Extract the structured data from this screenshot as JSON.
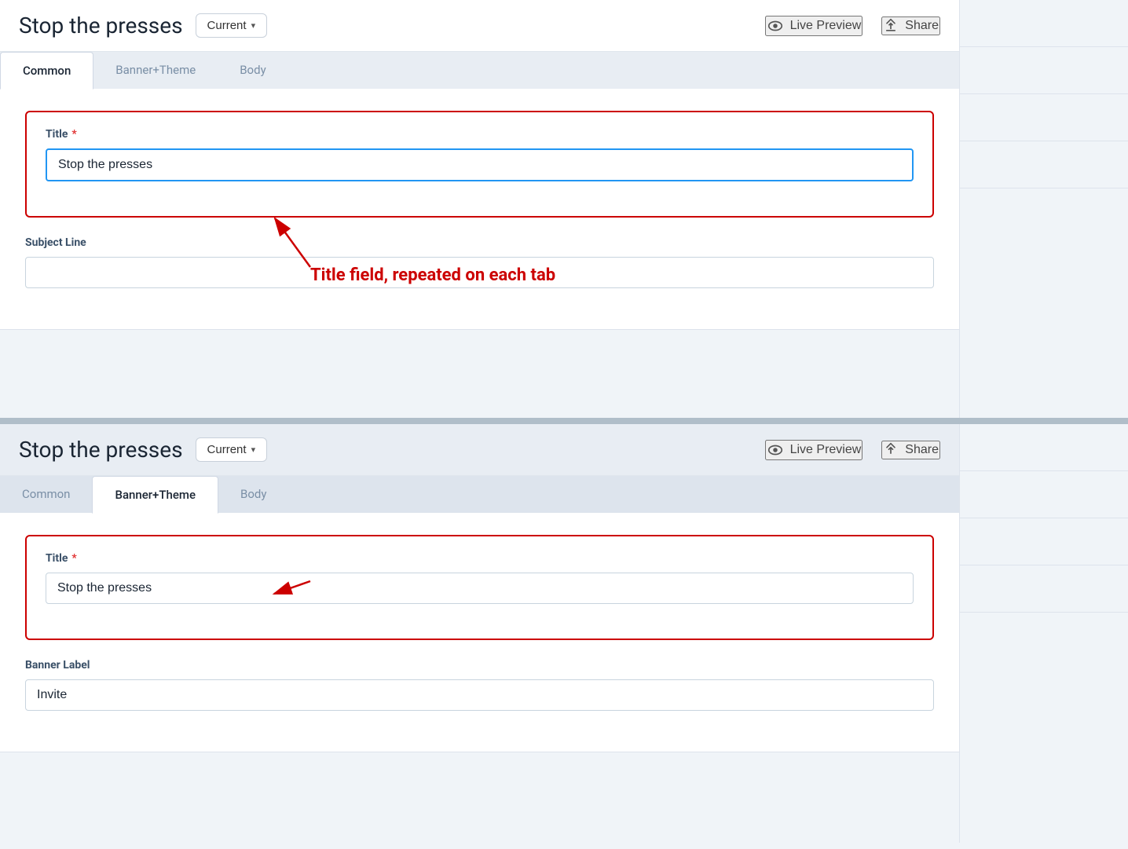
{
  "top": {
    "title": "Stop the presses",
    "version_label": "Current",
    "version_chevron": "▾",
    "live_preview_label": "Live Preview",
    "share_label": "Share",
    "tabs": [
      {
        "id": "common",
        "label": "Common",
        "active": true
      },
      {
        "id": "banner-theme",
        "label": "Banner+Theme",
        "active": false
      },
      {
        "id": "body",
        "label": "Body",
        "active": false
      }
    ],
    "title_field": {
      "label": "Title",
      "required": true,
      "value": "Stop the presses",
      "focused": true
    },
    "subject_line_field": {
      "label": "Subject Line",
      "required": false,
      "value": "",
      "placeholder": ""
    }
  },
  "bottom": {
    "title": "Stop the presses",
    "version_label": "Current",
    "version_chevron": "▾",
    "live_preview_label": "Live Preview",
    "share_label": "Share",
    "tabs": [
      {
        "id": "common",
        "label": "Common",
        "active": false
      },
      {
        "id": "banner-theme",
        "label": "Banner+Theme",
        "active": true
      },
      {
        "id": "body",
        "label": "Body",
        "active": false
      }
    ],
    "title_field": {
      "label": "Title",
      "required": true,
      "value": "Stop the presses"
    },
    "banner_label_field": {
      "label": "Banner Label",
      "value": "Invite"
    }
  },
  "annotation": {
    "text": "Title field, repeated on each tab"
  },
  "icons": {
    "eye": "👁",
    "share": "↪"
  }
}
